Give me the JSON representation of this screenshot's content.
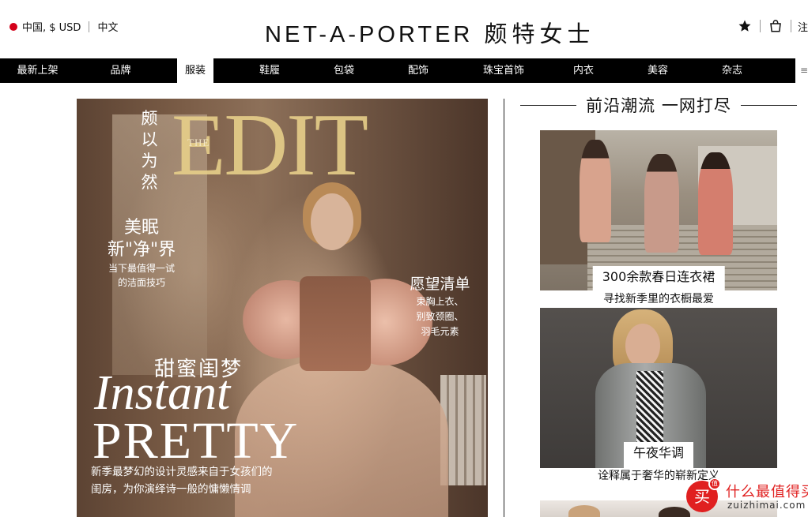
{
  "header": {
    "locale": "中国, $ USD",
    "language": "中文",
    "brand_en": "NET-A-PORTER",
    "brand_cn": "颇特女士",
    "register_label": "注",
    "icons": {
      "flag": "china-flag-dot-icon",
      "wishlist": "star-icon",
      "bag": "shopping-bag-icon"
    },
    "colors": {
      "flag": "#d4001a",
      "nav_bg": "#000000"
    }
  },
  "nav": {
    "items": [
      {
        "label": "最新上架"
      },
      {
        "label": "品牌"
      },
      {
        "label": "服装"
      },
      {
        "label": "鞋履"
      },
      {
        "label": "包袋"
      },
      {
        "label": "配饰"
      },
      {
        "label": "珠宝首饰"
      },
      {
        "label": "内衣"
      },
      {
        "label": "美容"
      },
      {
        "label": "杂志"
      }
    ],
    "active_index": 2,
    "tail": "≡"
  },
  "hero": {
    "vertical_cn": [
      "颇",
      "以",
      "为",
      "然"
    ],
    "the": "THE",
    "edit": "EDIT",
    "left_title_1": "美眠",
    "left_title_2": "新\"净\"界",
    "left_sub_1": "当下最值得一试",
    "left_sub_2": "的洁面技巧",
    "right_title": "愿望清单",
    "right_sub_1": "束胸上衣、",
    "right_sub_2": "别致颈圈、",
    "right_sub_3": "羽毛元素",
    "sweet": "甜蜜闺梦",
    "instant": "Instant",
    "pretty": "PRETTY",
    "caption_1": "新季最梦幻的设计灵感来自于女孩们的",
    "caption_2": "闺房，为你演绎诗一般的慵懒情调"
  },
  "right": {
    "section_title": "前沿潮流 一网打尽",
    "cards": [
      {
        "title": "300余款春日连衣裙",
        "subtitle": "寻找新季里的衣橱最爱"
      },
      {
        "title": "午夜华调",
        "subtitle": "诠释属于奢华的崭新定义"
      }
    ]
  },
  "watermark": {
    "badge": "买",
    "badge_small": "值",
    "cn": "什么最值得买",
    "en": "zuizhimai.com",
    "color": "#e02020"
  }
}
